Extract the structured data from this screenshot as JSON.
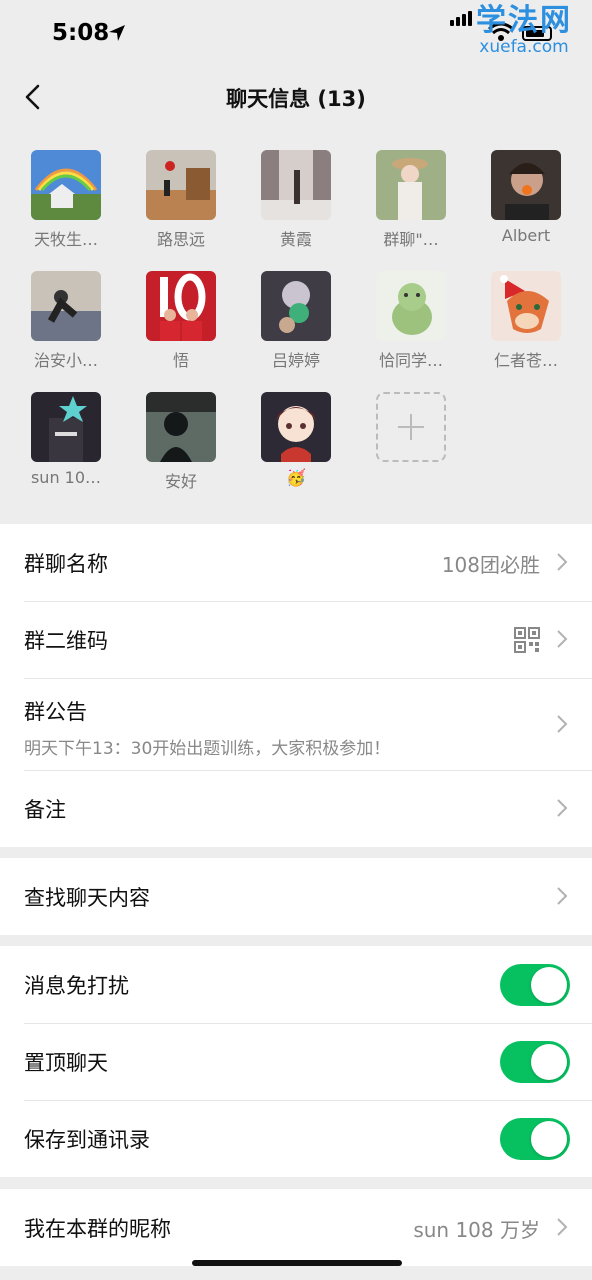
{
  "status": {
    "time": "5:08"
  },
  "watermark": {
    "cn": "学法网",
    "en": "xuefa.com"
  },
  "nav": {
    "title": "聊天信息 (13)"
  },
  "members": [
    {
      "name": "天牧生…",
      "bg": "#5b8fd0"
    },
    {
      "name": "路思远",
      "bg": "#b98e5c"
    },
    {
      "name": "黄霞",
      "bg": "#c9c2bf"
    },
    {
      "name": "群聊\"…",
      "bg": "#a7b692"
    },
    {
      "name": "Albert",
      "bg": "#4b3b30"
    },
    {
      "name": "治安小…",
      "bg": "#8d8f98"
    },
    {
      "name": "悟",
      "bg": "#c8242a"
    },
    {
      "name": "吕婷婷",
      "bg": "#55535c"
    },
    {
      "name": "恰同学…",
      "bg": "#cfd8c6"
    },
    {
      "name": "仁者苍…",
      "bg": "#e07a4a"
    },
    {
      "name": "sun 10…",
      "bg": "#2c2a34"
    },
    {
      "name": "安好",
      "bg": "#4e5a54"
    },
    {
      "name": "🥳",
      "bg": "#2d2a35"
    }
  ],
  "group_settings": {
    "name_label": "群聊名称",
    "name_value": "108团必胜",
    "qr_label": "群二维码",
    "notice_label": "群公告",
    "notice_text": "明天下午13：30开始出题训练，大家积极参加！",
    "remark_label": "备注"
  },
  "search": {
    "label": "查找聊天内容"
  },
  "toggles": [
    {
      "label": "消息免打扰",
      "on": true
    },
    {
      "label": "置顶聊天",
      "on": true
    },
    {
      "label": "保存到通讯录",
      "on": true
    }
  ],
  "nickname": {
    "label": "我在本群的昵称",
    "value": "sun 108 万岁"
  },
  "colors": {
    "accent": "#07c160",
    "background": "#ededed"
  }
}
